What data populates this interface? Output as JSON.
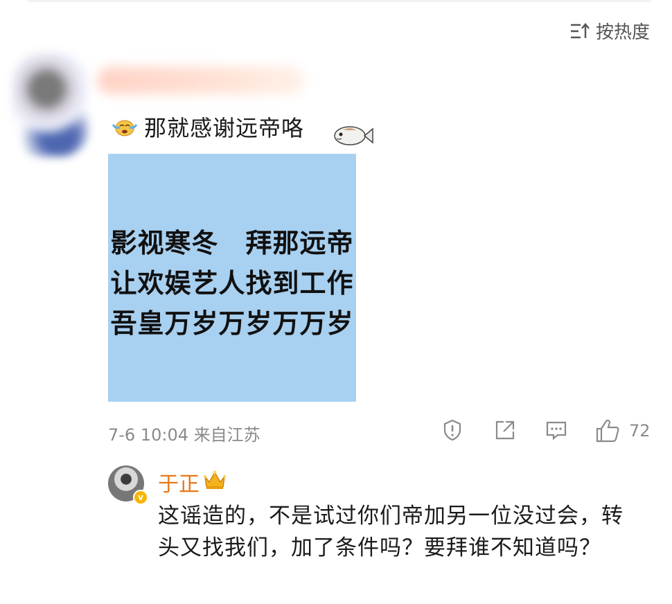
{
  "sort": {
    "label": "按热度",
    "icon": "sort-icon"
  },
  "comment": {
    "text": "那就感谢远帝咯",
    "leading_emoji": "crying-face-emoji",
    "trailing_emoji": "fish-emoji",
    "image": {
      "lines": [
        "影视寒冬　拜那远帝",
        "让欢娱艺人找到工作",
        "吾皇万岁万岁万万岁"
      ],
      "background": "#a8d0f0"
    },
    "meta": "7-6 10:04 来自江苏",
    "like_count": "72"
  },
  "reply": {
    "name": "于正",
    "name_color": "#e8771a",
    "badge_icon": "crown-emoji",
    "verified_icon": "verified-badge-icon",
    "text": "这谣造的，不是试过你们帝加另一位没过会，转头又找我们，加了条件吗？要拜谁不知道吗？"
  }
}
